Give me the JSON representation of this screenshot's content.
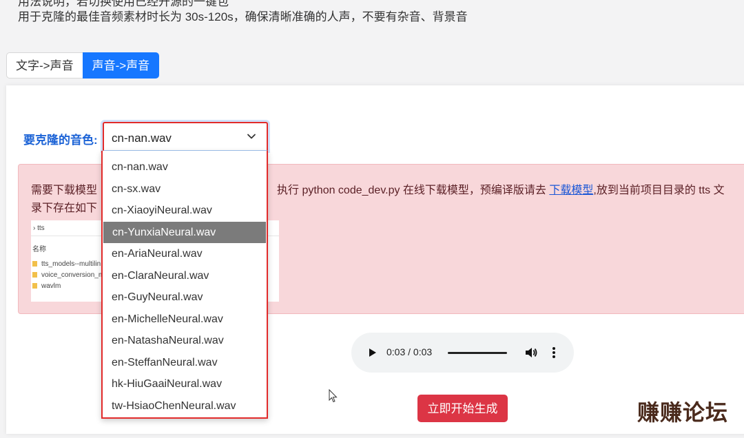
{
  "intro": {
    "line1": "用法说明，若切换使用已经开源的一键包",
    "line2": "用于克隆的最佳音频素材时长为 30s-120s，确保清晰准确的人声，不要有杂音、背景音"
  },
  "tabs": [
    {
      "label": "文字->声音",
      "active": false
    },
    {
      "label": "声音->声音",
      "active": true
    }
  ],
  "voice_select": {
    "label": "要克隆的音色:",
    "selected": "cn-nan.wav",
    "options": [
      "cn-nan.wav",
      "cn-sx.wav",
      "cn-XiaoyiNeural.wav",
      "cn-YunxiaNeural.wav",
      "en-AriaNeural.wav",
      "en-ClaraNeural.wav",
      "en-GuyNeural.wav",
      "en-MichelleNeural.wav",
      "en-NatashaNeural.wav",
      "en-SteffanNeural.wav",
      "hk-HiuGaaiNeural.wav",
      "tw-HsiaoChenNeural.wav"
    ],
    "highlighted": "cn-YunxiaNeural.wav"
  },
  "alert": {
    "prefix": "需要下载模型",
    "middle": "执行 python code_dev.py 在线下载模型，预编译版请去 ",
    "link": "下载模型",
    "suffix": ",放到当前项目目录的 tts 文",
    "cont": "录下存在如下",
    "folder": {
      "path": "tts",
      "column": "名称",
      "items": [
        "tts_models--multilin",
        "voice_conversion_m",
        "wavlm"
      ]
    }
  },
  "audio": {
    "time": "0:03 / 0:03",
    "progress_fraction": 1.0
  },
  "generate_button": "立即开始生成",
  "watermark": "赚赚论坛",
  "colors": {
    "primary": "#1677ff",
    "danger": "#dc3545",
    "alert_bg": "#f8d7da",
    "highlight": "#7b7b7b"
  }
}
